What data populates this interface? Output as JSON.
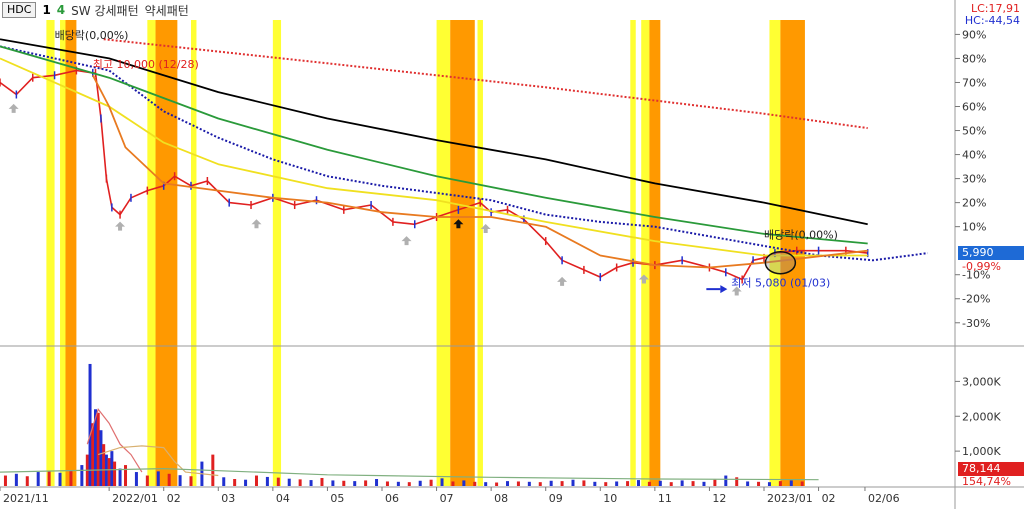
{
  "header": {
    "ticker": "HDC",
    "period_a": "1",
    "period_b": "4",
    "sw_label": "SW 강세패턴",
    "weak_label": "약세패턴"
  },
  "corner": {
    "lc": "LC:17,91",
    "hc": "HC:-44,54"
  },
  "price_tags": {
    "price": "5,990",
    "change": "-0,99%",
    "volume": "78,144",
    "volume_pct": "154,74%"
  },
  "colors": {
    "accent_red": "#e02020",
    "accent_blue": "#2030d0",
    "price_tag_bg": "#1e6ad6",
    "volume_tag_bg": "#e02020",
    "band_yellow": "#ffff33",
    "band_orange": "#ff9900"
  },
  "chart_data": [
    {
      "type": "line",
      "panel": "price",
      "y_axis_labels": [
        "90%",
        "80%",
        "70%",
        "60%",
        "50%",
        "40%",
        "30%",
        "20%",
        "10%",
        "-10%",
        "-20%",
        "-30%"
      ],
      "y_axis_values": [
        90,
        80,
        70,
        60,
        50,
        40,
        30,
        20,
        10,
        -10,
        -20,
        -30
      ],
      "ylim": [
        -38,
        96
      ],
      "x_axis_labels": [
        "2021/11",
        "2022/01",
        "02",
        "03",
        "04",
        "05",
        "06",
        "07",
        "08",
        "09",
        "10",
        "11",
        "12",
        "2023/01",
        "02",
        "02/06"
      ],
      "x_months": [
        0,
        2,
        3,
        4,
        5,
        6,
        7,
        8,
        9,
        10,
        11,
        12,
        13,
        14,
        15,
        15.85
      ],
      "xlim": [
        0,
        17.5
      ],
      "annotations": [
        {
          "text": "배당락(0,00%)",
          "x": 1.0,
          "y": 88
        },
        {
          "text": "최고 10,000 (12/28)",
          "x": 1.7,
          "y": 76
        },
        {
          "text": "배당락(0,00%)",
          "x": 14.0,
          "y": 5
        },
        {
          "text": "최저 5,080 (01/03)",
          "x": 13.4,
          "y": -15
        }
      ],
      "series": [
        {
          "name": "",
          "color": "#e02020",
          "style": "price",
          "x": [
            0,
            0.3,
            0.6,
            1,
            1.4,
            1.7,
            1.75,
            1.85,
            1.95,
            2.05,
            2.2,
            2.4,
            2.7,
            3,
            3.2,
            3.5,
            3.8,
            4.2,
            4.6,
            5,
            5.4,
            5.8,
            6.3,
            6.8,
            7.2,
            7.6,
            8,
            8.4,
            8.8,
            9,
            9.3,
            9.6,
            10,
            10.3,
            10.7,
            11,
            11.3,
            11.6,
            12,
            12.5,
            13,
            13.3,
            13.6,
            13.8,
            14,
            14.2,
            14.6,
            15,
            15.5,
            15.9
          ],
          "y": [
            70,
            65,
            72,
            73,
            75,
            74,
            74,
            55,
            30,
            18,
            15,
            22,
            25,
            27,
            31,
            27,
            29,
            20,
            19,
            22,
            19,
            21,
            17,
            19,
            12,
            11,
            14,
            17,
            20,
            16,
            17,
            13,
            4,
            -4,
            -8,
            -11,
            -7,
            -5,
            -6,
            -4,
            -7,
            -9,
            -12,
            -4,
            -3,
            -1,
            0,
            0,
            0,
            -1
          ]
        },
        {
          "name": "",
          "color": "#1a1aa8",
          "style": "dotted",
          "x": [
            0,
            1,
            2,
            3,
            4,
            5,
            6,
            7,
            8,
            9,
            10,
            11,
            12,
            13,
            14,
            15,
            16,
            17
          ],
          "y": [
            85,
            80,
            75,
            58,
            47,
            38,
            31,
            27,
            24,
            21,
            15,
            12,
            10,
            6,
            2,
            -2,
            -4,
            -1
          ]
        },
        {
          "name": "",
          "color": "#000000",
          "style": "solid",
          "x": [
            0,
            2,
            4,
            6,
            8,
            10,
            12,
            14,
            15.9
          ],
          "y": [
            88,
            80,
            66,
            55,
            46,
            38,
            28,
            20,
            11
          ]
        },
        {
          "name": "",
          "color": "#2a9a3a",
          "style": "solid",
          "x": [
            0,
            2,
            4,
            6,
            8,
            10,
            12,
            14,
            15.9
          ],
          "y": [
            85,
            72,
            55,
            42,
            31,
            22,
            14,
            7,
            3
          ]
        },
        {
          "name": "",
          "color": "#f0e020",
          "style": "solid",
          "x": [
            0,
            2,
            3,
            4,
            6,
            8,
            10,
            12,
            14,
            15.9
          ],
          "y": [
            80,
            60,
            45,
            36,
            26,
            21,
            12,
            4,
            -2,
            -2
          ]
        },
        {
          "name": "",
          "color": "#e87a20",
          "style": "solid",
          "x": [
            1.7,
            2,
            2.3,
            3,
            4,
            5,
            6,
            7,
            8,
            9,
            10,
            11,
            12,
            13,
            14,
            15.9
          ],
          "y": [
            73,
            60,
            43,
            28,
            25,
            22,
            20,
            16,
            14,
            14,
            10,
            -2,
            -6,
            -7,
            -5,
            0
          ]
        },
        {
          "name": "",
          "color": "#e03030",
          "style": "dotted",
          "x": [
            1.9,
            6,
            10,
            14,
            15.9
          ],
          "y": [
            88,
            78,
            68,
            57,
            51
          ]
        }
      ],
      "event_bands": [
        {
          "color": "yellow",
          "start": 0.85,
          "end": 1.0
        },
        {
          "color": "yellow",
          "start": 1.1,
          "end": 1.2
        },
        {
          "color": "orange",
          "start": 1.2,
          "end": 1.4
        },
        {
          "color": "yellow",
          "start": 2.7,
          "end": 2.85
        },
        {
          "color": "orange",
          "start": 2.85,
          "end": 3.25
        },
        {
          "color": "yellow",
          "start": 3.5,
          "end": 3.6
        },
        {
          "color": "yellow",
          "start": 5.0,
          "end": 5.15
        },
        {
          "color": "yellow",
          "start": 8.0,
          "end": 8.25
        },
        {
          "color": "orange",
          "start": 8.25,
          "end": 8.7
        },
        {
          "color": "yellow",
          "start": 8.75,
          "end": 8.85
        },
        {
          "color": "yellow",
          "start": 11.55,
          "end": 11.65
        },
        {
          "color": "yellow",
          "start": 11.75,
          "end": 11.9
        },
        {
          "color": "orange",
          "start": 11.9,
          "end": 12.1
        },
        {
          "color": "yellow",
          "start": 14.1,
          "end": 14.3
        },
        {
          "color": "orange",
          "start": 14.3,
          "end": 14.75
        }
      ],
      "markers": [
        {
          "kind": "gray-up",
          "x": 0.25,
          "y": 59
        },
        {
          "kind": "gray-up",
          "x": 2.2,
          "y": 10
        },
        {
          "kind": "gray-up",
          "x": 4.7,
          "y": 11
        },
        {
          "kind": "gray-up",
          "x": 7.45,
          "y": 4
        },
        {
          "kind": "black-up",
          "x": 8.4,
          "y": 11
        },
        {
          "kind": "gray-up",
          "x": 8.9,
          "y": 9
        },
        {
          "kind": "gray-up",
          "x": 10.3,
          "y": -13
        },
        {
          "kind": "gray-up",
          "x": 11.8,
          "y": -12
        },
        {
          "kind": "gray-up",
          "x": 13.5,
          "y": -17
        },
        {
          "kind": "blue-right",
          "x": 13.2,
          "y": -16
        }
      ]
    },
    {
      "type": "bar",
      "panel": "volume",
      "y_axis_labels": [
        "3,000K",
        "2,000K",
        "1,000K"
      ],
      "y_axis_values": [
        3000,
        2000,
        1000
      ],
      "ylim": [
        0,
        3900
      ],
      "x": [
        0.1,
        0.3,
        0.5,
        0.7,
        0.9,
        1.1,
        1.3,
        1.5,
        1.6,
        1.65,
        1.7,
        1.75,
        1.8,
        1.85,
        1.9,
        1.95,
        2.0,
        2.05,
        2.1,
        2.2,
        2.3,
        2.5,
        2.7,
        2.9,
        3.1,
        3.3,
        3.5,
        3.7,
        3.9,
        4.1,
        4.3,
        4.5,
        4.7,
        4.9,
        5.1,
        5.3,
        5.5,
        5.7,
        5.9,
        6.1,
        6.3,
        6.5,
        6.7,
        6.9,
        7.1,
        7.3,
        7.5,
        7.7,
        7.9,
        8.1,
        8.3,
        8.5,
        8.7,
        8.9,
        9.1,
        9.3,
        9.5,
        9.7,
        9.9,
        10.1,
        10.3,
        10.5,
        10.7,
        10.9,
        11.1,
        11.3,
        11.5,
        11.7,
        11.9,
        12.1,
        12.3,
        12.5,
        12.7,
        12.9,
        13.1,
        13.3,
        13.5,
        13.7,
        13.9,
        14.1,
        14.3,
        14.5,
        14.7
      ],
      "values": [
        300,
        350,
        280,
        400,
        420,
        380,
        450,
        600,
        900,
        3500,
        1800,
        2200,
        2100,
        1600,
        1200,
        900,
        800,
        1000,
        700,
        500,
        600,
        400,
        300,
        420,
        350,
        310,
        280,
        700,
        900,
        250,
        200,
        180,
        300,
        260,
        240,
        210,
        190,
        170,
        230,
        160,
        150,
        140,
        160,
        200,
        130,
        120,
        110,
        150,
        180,
        220,
        130,
        160,
        120,
        110,
        100,
        140,
        130,
        120,
        110,
        150,
        140,
        180,
        160,
        120,
        110,
        130,
        140,
        170,
        120,
        150,
        110,
        160,
        140,
        120,
        180,
        300,
        250,
        130,
        120,
        110,
        140,
        160,
        130
      ],
      "colors_rule": "alternating red/blue",
      "series": [
        {
          "name": "",
          "color": "#e07070",
          "x": [
            1.6,
            1.8,
            2.0,
            2.2,
            2.4,
            2.6
          ],
          "y": [
            1200,
            2200,
            1800,
            1200,
            900,
            400
          ]
        },
        {
          "name": "",
          "color": "#d8b070",
          "x": [
            1.8,
            2.2,
            2.6,
            3.0,
            3.2,
            3.4,
            4.0
          ],
          "y": [
            900,
            1100,
            1150,
            1100,
            700,
            400,
            300
          ]
        },
        {
          "name": "",
          "color": "#80b080",
          "x": [
            0,
            3,
            6,
            9,
            12,
            15
          ],
          "y": [
            400,
            500,
            320,
            250,
            200,
            180
          ]
        }
      ]
    }
  ]
}
